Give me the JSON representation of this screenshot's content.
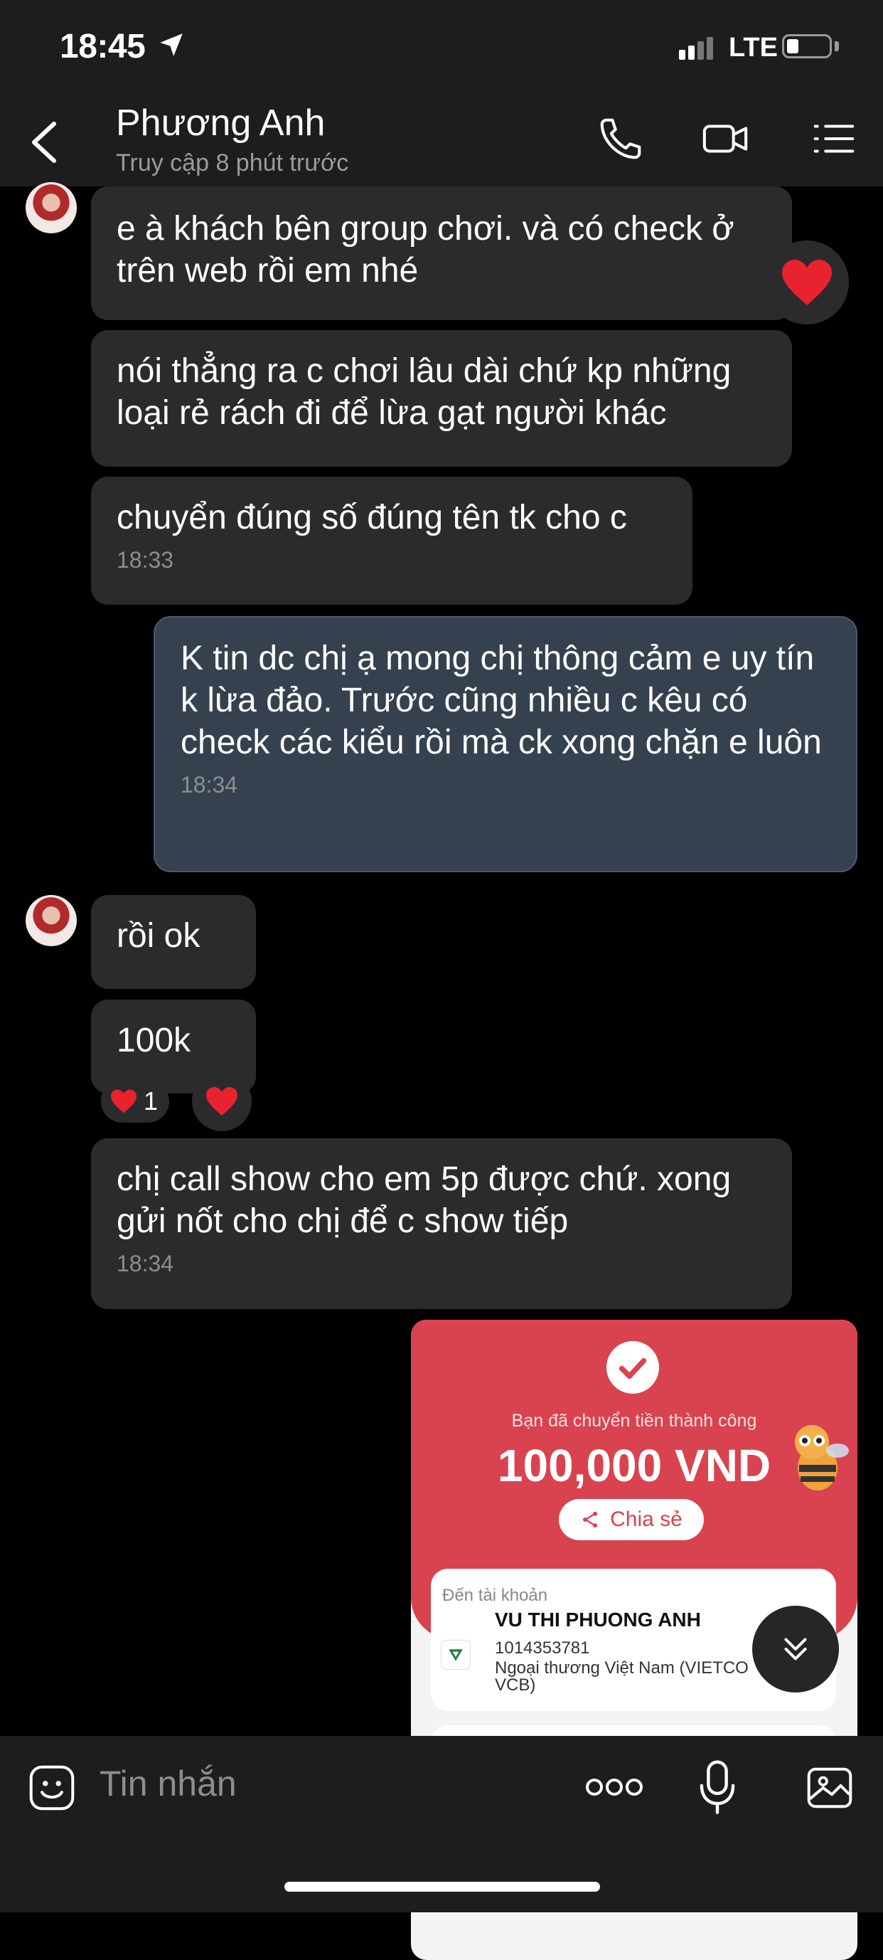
{
  "status_bar": {
    "time": "18:45",
    "network": "LTE"
  },
  "header": {
    "contact_name": "Phương Anh",
    "last_seen": "Truy cập 8 phút trước"
  },
  "messages": [
    {
      "text": "e à khách bên group chơi. và có check ở trên web rồi em nhé"
    },
    {
      "text": "nói thẳng ra c chơi lâu dài chứ kp những loại rẻ rách đi để lừa gạt người khác"
    },
    {
      "text": "chuyển đúng số đúng tên tk cho c",
      "time": "18:33"
    },
    {
      "text": "K tin dc chị ạ mong chị thông cảm e uy tín k lừa đảo. Trước cũng nhiều c kêu có check các kiểu rồi mà ck xong chặn e luôn",
      "time": "18:34"
    },
    {
      "text": "rồi ok"
    },
    {
      "text": "100k",
      "reaction_count": "1"
    },
    {
      "text": "chị call show cho em 5p được chứ. xong gửi nốt cho chị để c show tiếp",
      "time": "18:34"
    }
  ],
  "receipt": {
    "subtitle": "Bạn đã chuyển tiền thành công",
    "amount": "100,000 VND",
    "share_label": "Chia sẻ",
    "to_label": "Đến tài khoản",
    "recipient_name": "VU THI PHUONG ANH",
    "account_number": "1014353781",
    "bank": "Ngoại thương Việt Nam (VIETCO VCB)"
  },
  "composer": {
    "placeholder": "Tin nhắn"
  },
  "colors": {
    "accent_red": "#d8434f",
    "bubble_other": "#2b2b2d",
    "bubble_me": "#364150"
  }
}
